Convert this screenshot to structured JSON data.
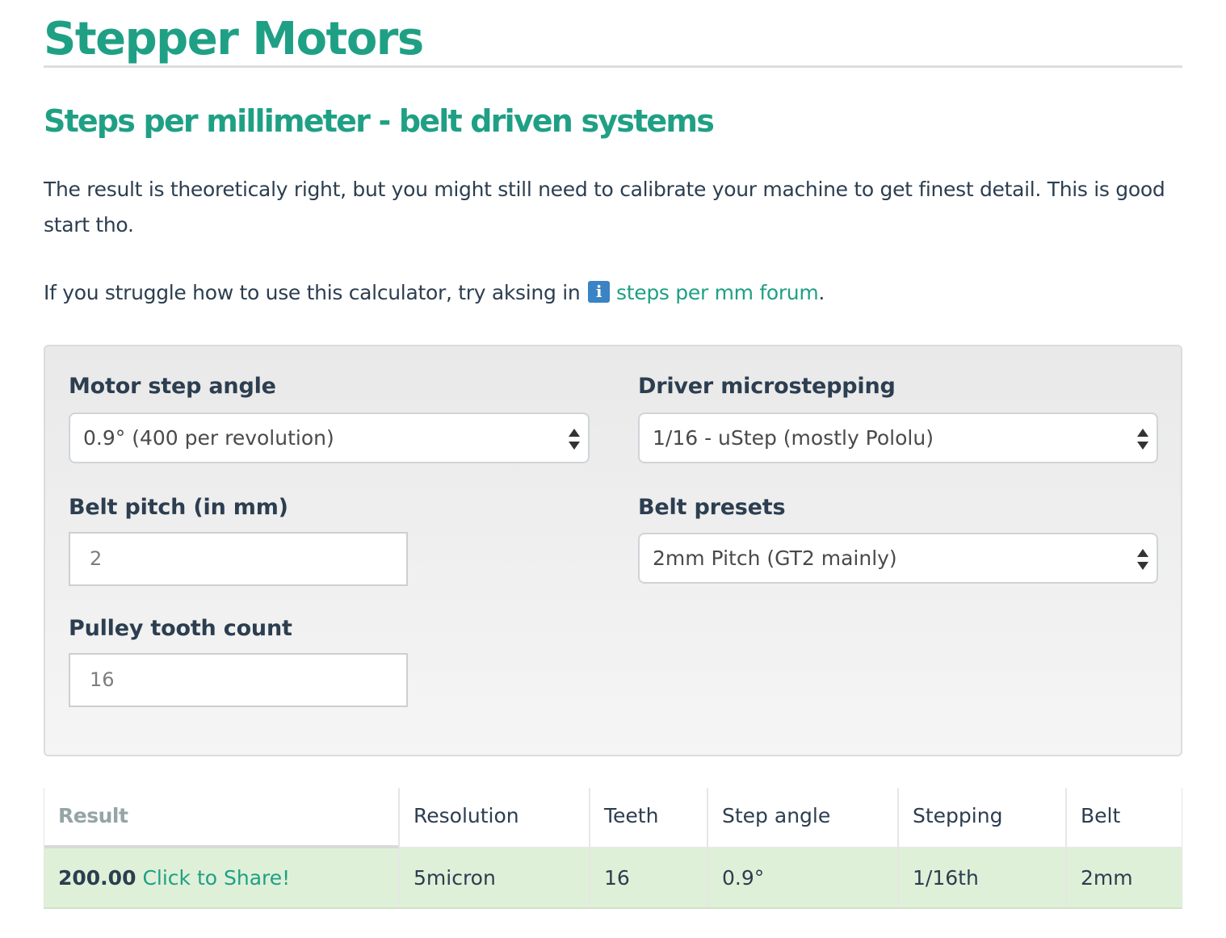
{
  "page": {
    "title": "Stepper Motors",
    "subtitle": "Steps per millimeter - belt driven systems",
    "intro": "The result is theoreticaly right, but you might still need to calibrate your machine to get finest detail. This is good start tho.",
    "help_prefix": "If you struggle how to use this calculator, try aksing in",
    "help_icon": "i",
    "help_link": "steps per mm forum",
    "help_suffix": "."
  },
  "form": {
    "motor_step_angle": {
      "label": "Motor step angle",
      "value": "0.9° (400 per revolution)"
    },
    "driver_microstepping": {
      "label": "Driver microstepping",
      "value": "1/16 - uStep (mostly Pololu)"
    },
    "belt_pitch": {
      "label": "Belt pitch (in mm)",
      "value": "2"
    },
    "belt_presets": {
      "label": "Belt presets",
      "value": "2mm Pitch (GT2 mainly)"
    },
    "pulley_tooth_count": {
      "label": "Pulley tooth count",
      "value": "16"
    }
  },
  "results": {
    "headers": [
      "Result",
      "Resolution",
      "Teeth",
      "Step angle",
      "Stepping",
      "Belt"
    ],
    "row": {
      "result_value": "200.00",
      "share_label": "Click to Share!",
      "resolution": "5micron",
      "teeth": "16",
      "step_angle": "0.9°",
      "stepping": "1/16th",
      "belt": "2mm"
    }
  },
  "colors": {
    "accent": "#1fa085",
    "info_icon": "#3a83c4",
    "result_row_bg": "#dff0d8",
    "text": "#2c3e50"
  }
}
